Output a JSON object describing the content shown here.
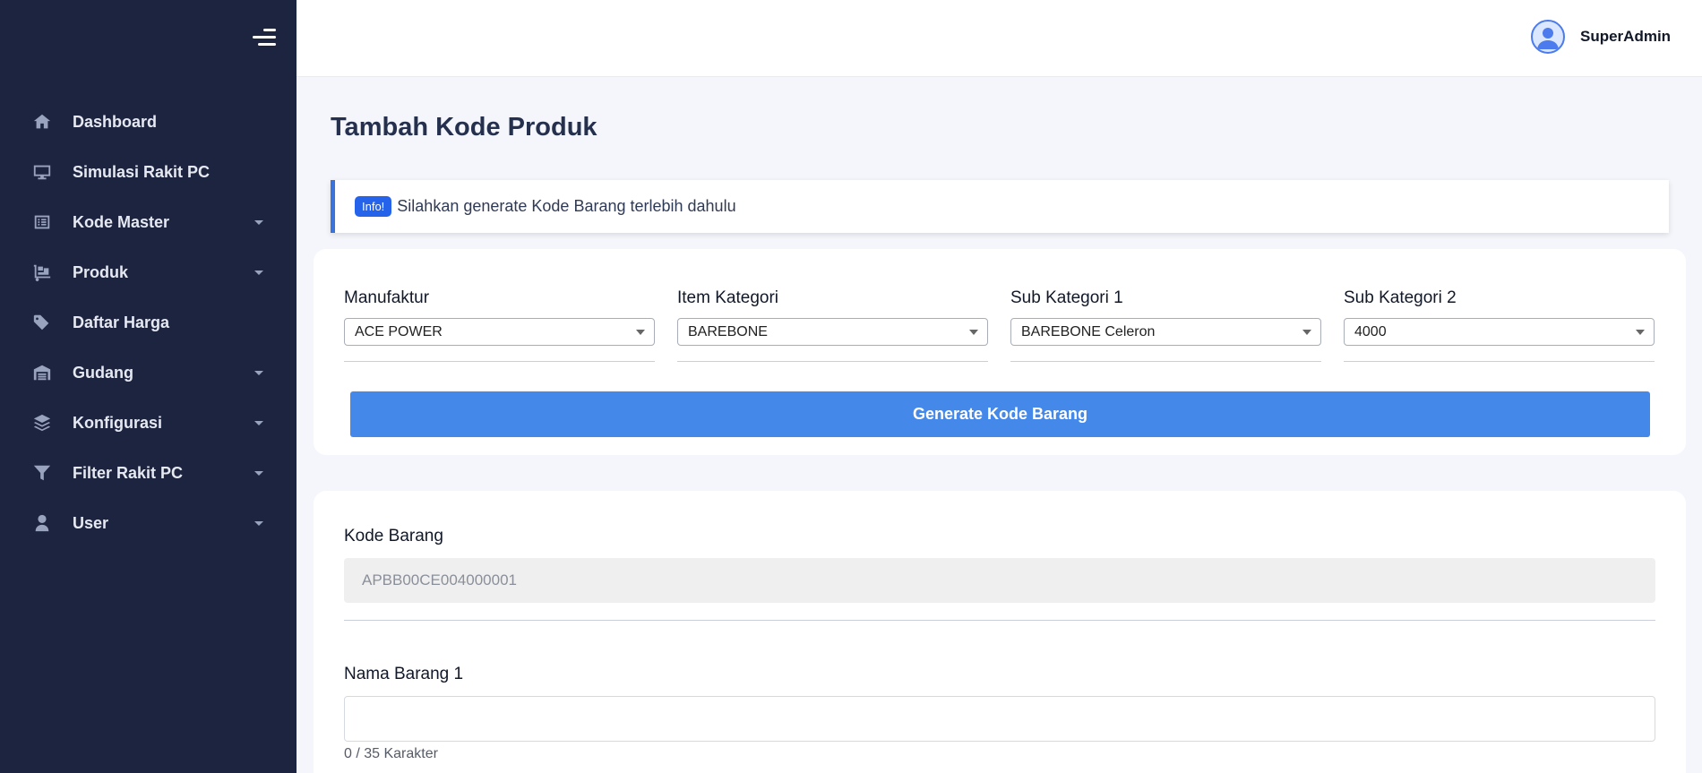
{
  "sidebar": {
    "items": [
      {
        "label": "Dashboard",
        "icon": "home-icon",
        "has_submenu": false
      },
      {
        "label": "Simulasi Rakit PC",
        "icon": "monitor-icon",
        "has_submenu": false
      },
      {
        "label": "Kode Master",
        "icon": "list-icon",
        "has_submenu": true
      },
      {
        "label": "Produk",
        "icon": "dolly-icon",
        "has_submenu": true
      },
      {
        "label": "Daftar Harga",
        "icon": "tags-icon",
        "has_submenu": false
      },
      {
        "label": "Gudang",
        "icon": "warehouse-icon",
        "has_submenu": true
      },
      {
        "label": "Konfigurasi",
        "icon": "layers-icon",
        "has_submenu": true
      },
      {
        "label": "Filter Rakit PC",
        "icon": "filter-icon",
        "has_submenu": true
      },
      {
        "label": "User",
        "icon": "user-icon",
        "has_submenu": true
      }
    ]
  },
  "header": {
    "username": "SuperAdmin"
  },
  "page": {
    "title": "Tambah Kode Produk"
  },
  "alert": {
    "badge": "Info!",
    "message": "Silahkan generate Kode Barang terlebih dahulu"
  },
  "filters": [
    {
      "label": "Manufaktur",
      "value": "ACE POWER"
    },
    {
      "label": "Item Kategori",
      "value": "BAREBONE"
    },
    {
      "label": "Sub Kategori 1",
      "value": "BAREBONE Celeron"
    },
    {
      "label": "Sub Kategori 2",
      "value": "4000"
    }
  ],
  "generate_button": "Generate Kode Barang",
  "kode_barang": {
    "label": "Kode Barang",
    "value": "APBB00CE004000001"
  },
  "nama_barang": {
    "label": "Nama Barang 1",
    "value": "",
    "counter": "0 / 35 Karakter"
  },
  "colors": {
    "sidebar_bg": "#1d2440",
    "accent": "#4489e9",
    "badge": "#2563eb",
    "page_bg": "#f4f6fb"
  }
}
